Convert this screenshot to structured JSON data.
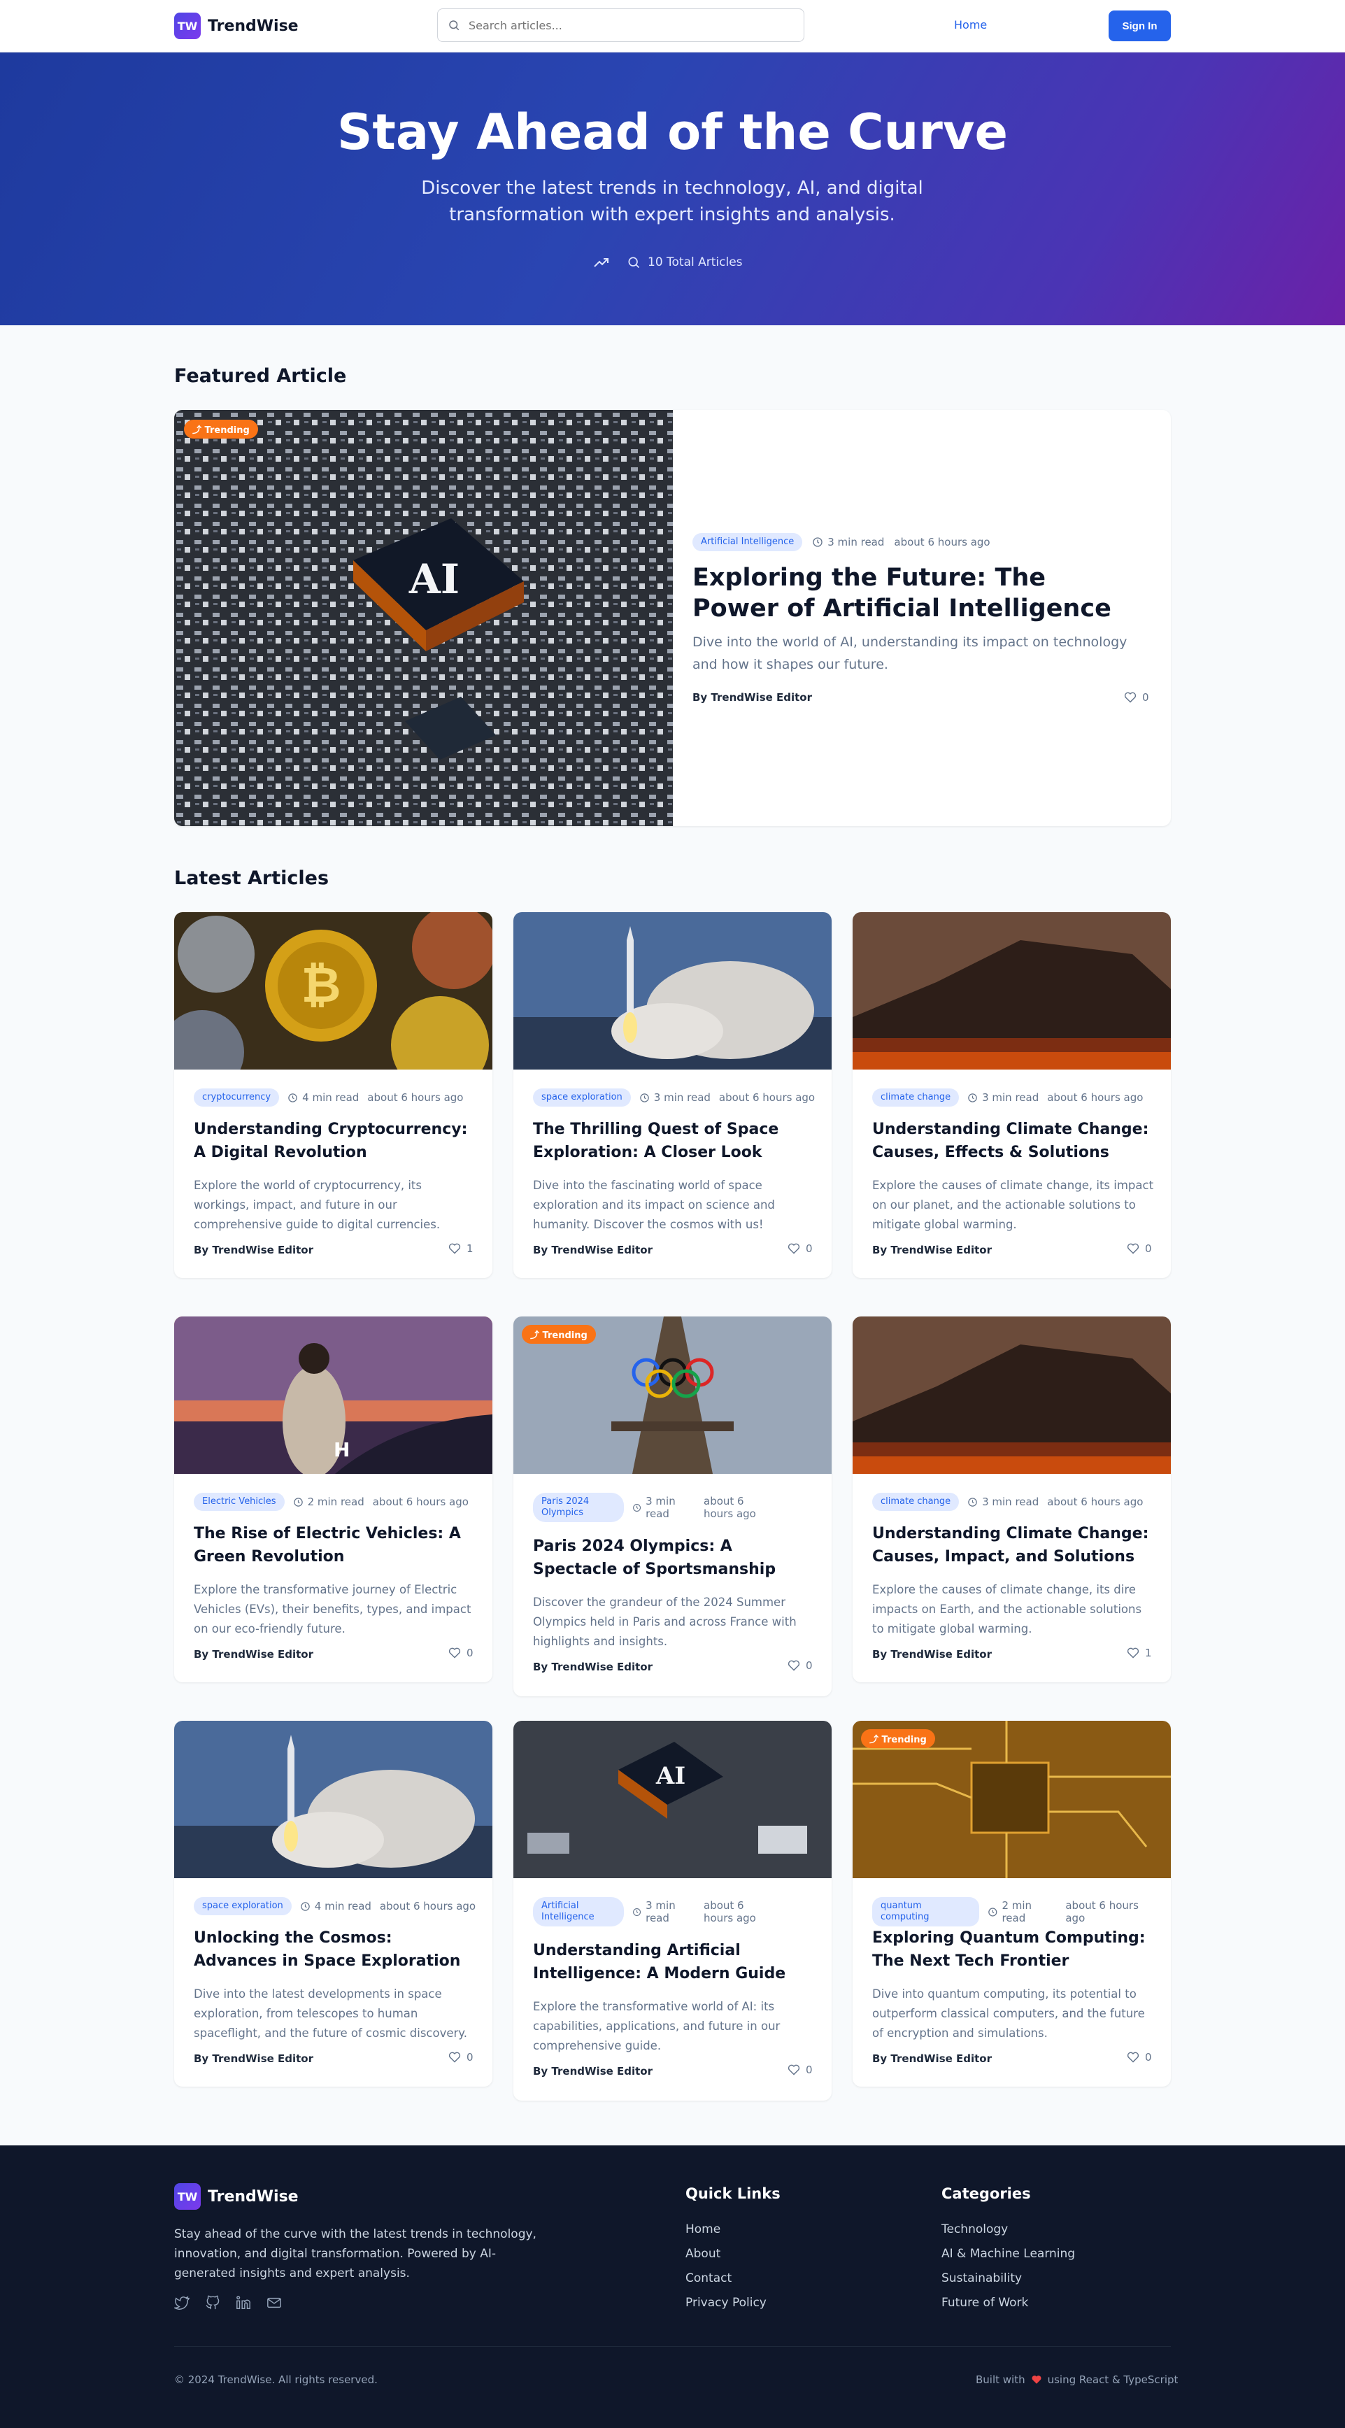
{
  "header": {
    "logo_mark": "TW",
    "brand": "TrendWise",
    "search_placeholder": "Search articles...",
    "nav_home": "Home",
    "sign_in": "Sign In"
  },
  "hero": {
    "title": "Stay Ahead of the Curve",
    "subtitle": "Discover the latest trends in technology, AI, and digital transformation with expert insights and analysis.",
    "total_articles": "10 Total Articles"
  },
  "featured": {
    "section_title": "Featured Article",
    "trending_label": "Trending",
    "category": "Artificial Intelligence",
    "read_time": "3 min read",
    "posted": "about 6 hours ago",
    "title": "Exploring the Future: The Power of Artificial Intelligence",
    "excerpt": "Dive into the world of AI, understanding its impact on technology and how it shapes our future.",
    "author": "By TrendWise Editor",
    "likes": "0",
    "image_icon": "ai-chip-image"
  },
  "latest": {
    "section_title": "Latest Articles",
    "trending_label": "Trending",
    "articles": [
      {
        "category": "cryptocurrency",
        "read_time": "4 min read",
        "posted": "about 6 hours ago",
        "title": "Understanding Cryptocurrency: A Digital Revolution",
        "excerpt": "Explore the world of cryptocurrency, its workings, impact, and future in our comprehensive guide to digital currencies.",
        "author": "By TrendWise Editor",
        "likes": "1",
        "trending": false,
        "image": "coins"
      },
      {
        "category": "space exploration",
        "read_time": "3 min read",
        "posted": "about 6 hours ago",
        "title": "The Thrilling Quest of Space Exploration: A Closer Look",
        "excerpt": "Dive into the fascinating world of space exploration and its impact on science and humanity. Discover the cosmos with us!",
        "author": "By TrendWise Editor",
        "likes": "0",
        "trending": false,
        "image": "rocket"
      },
      {
        "category": "climate change",
        "read_time": "3 min read",
        "posted": "about 6 hours ago",
        "title": "Understanding Climate Change: Causes, Effects & Solutions",
        "excerpt": "Explore the causes of climate change, its impact on our planet, and the actionable solutions to mitigate global warming.",
        "author": "By TrendWise Editor",
        "likes": "0",
        "trending": false,
        "image": "wildfire"
      },
      {
        "category": "Electric Vehicles",
        "read_time": "2 min read",
        "posted": "about 6 hours ago",
        "title": "The Rise of Electric Vehicles: A Green Revolution",
        "excerpt": "Explore the transformative journey of Electric Vehicles (EVs), their benefits, types, and impact on our eco-friendly future.",
        "author": "By TrendWise Editor",
        "likes": "0",
        "trending": false,
        "image": "ev"
      },
      {
        "category": "Paris 2024 Olympics",
        "read_time": "3 min read",
        "posted": "about 6 hours ago",
        "title": "Paris 2024 Olympics: A Spectacle of Sportsmanship",
        "excerpt": "Discover the grandeur of the 2024 Summer Olympics held in Paris and across France with highlights and insights.",
        "author": "By TrendWise Editor",
        "likes": "0",
        "trending": true,
        "image": "eiffel"
      },
      {
        "category": "climate change",
        "read_time": "3 min read",
        "posted": "about 6 hours ago",
        "title": "Understanding Climate Change: Causes, Impact, and Solutions",
        "excerpt": "Explore the causes of climate change, its dire impacts on Earth, and the actionable solutions to mitigate global warming.",
        "author": "By TrendWise Editor",
        "likes": "1",
        "trending": false,
        "image": "wildfire"
      },
      {
        "category": "space exploration",
        "read_time": "4 min read",
        "posted": "about 6 hours ago",
        "title": "Unlocking the Cosmos: Advances in Space Exploration",
        "excerpt": "Dive into the latest developments in space exploration, from telescopes to human spaceflight, and the future of cosmic discovery.",
        "author": "By TrendWise Editor",
        "likes": "0",
        "trending": false,
        "image": "rocket"
      },
      {
        "category": "Artificial Intelligence",
        "read_time": "3 min read",
        "posted": "about 6 hours ago",
        "title": "Understanding Artificial Intelligence: A Modern Guide",
        "excerpt": "Explore the transformative world of AI: its capabilities, applications, and future in our comprehensive guide.",
        "author": "By TrendWise Editor",
        "likes": "0",
        "trending": false,
        "image": "ai"
      },
      {
        "category": "quantum computing",
        "read_time": "2 min read",
        "posted": "about 6 hours ago",
        "title": "Exploring Quantum Computing: The Next Tech Frontier",
        "excerpt": "Dive into quantum computing, its potential to outperform classical computers, and the future of encryption and simulations.",
        "author": "By TrendWise Editor",
        "likes": "0",
        "trending": true,
        "image": "circuit"
      }
    ]
  },
  "footer": {
    "logo_mark": "TW",
    "brand": "TrendWise",
    "description": "Stay ahead of the curve with the latest trends in technology, innovation, and digital transformation. Powered by AI-generated insights and expert analysis.",
    "quick_links_title": "Quick Links",
    "quick_links": [
      "Home",
      "About",
      "Contact",
      "Privacy Policy"
    ],
    "categories_title": "Categories",
    "categories": [
      "Technology",
      "AI & Machine Learning",
      "Sustainability",
      "Future of Work"
    ],
    "copyright": "© 2024 TrendWise. All rights reserved.",
    "built_with_prefix": "Built with",
    "built_with_suffix": "using React & TypeScript",
    "social_icons": [
      "twitter-icon",
      "github-icon",
      "linkedin-icon",
      "mail-icon"
    ]
  },
  "colors": {
    "accent": "#2563eb",
    "trending": "#f97316",
    "footer_bg": "#0f172a",
    "heart": "#ef4444"
  }
}
